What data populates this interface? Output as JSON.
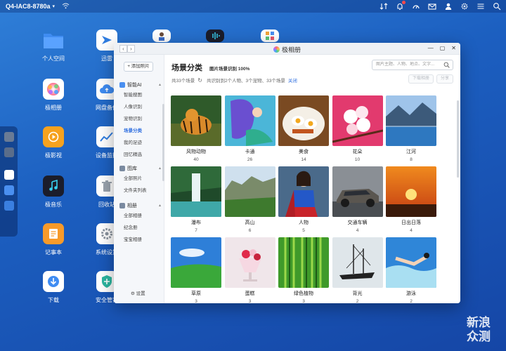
{
  "topbar": {
    "device_name": "Q4-IAC8-8780a"
  },
  "desktop": {
    "icons": [
      {
        "label": "个人空间",
        "color": "#3f8cf2"
      },
      {
        "label": "迅雷",
        "color": "#ffffff"
      },
      {
        "label": "极相册",
        "color": "#ffffff"
      },
      {
        "label": "网盘备份",
        "color": "#ffffff"
      },
      {
        "label": "极影视",
        "color": "#f6a21e"
      },
      {
        "label": "设备监控",
        "color": "#ffffff"
      },
      {
        "label": "极音乐",
        "color": "#1b1d2b"
      },
      {
        "label": "回收站",
        "color": "#ffffff"
      },
      {
        "label": "记事本",
        "color": "#f79a2a"
      },
      {
        "label": "系统设置",
        "color": "#ffffff"
      },
      {
        "label": "下载",
        "color": "#ffffff"
      },
      {
        "label": "安全管家",
        "color": "#ffffff"
      }
    ]
  },
  "window": {
    "title": "极相册",
    "nav_back": "‹",
    "nav_forward": "›"
  },
  "sidebar": {
    "add_button": "+ 添加照片",
    "groups": [
      {
        "title": "智能AI",
        "items": [
          "智能搜图",
          "人像识别",
          "宠物识别",
          "场景分类",
          "我的足迹",
          "回忆精选"
        ]
      },
      {
        "title": "图库",
        "items": [
          "全部照片",
          "文件夹列表"
        ]
      },
      {
        "title": "相册",
        "items": [
          "全部相册",
          "纪念册",
          "宝宝相册",
          "宝宝相册"
        ]
      }
    ],
    "settings_label": "设置"
  },
  "main": {
    "title": "场景分类",
    "status": "图片场景识别 100%",
    "search_placeholder": "图片主题、人物、地点、文字...",
    "count_text": "共33个场景",
    "recognized_text": "共识别到2个人物、3个宠物、33个场景",
    "close_link": "关闭",
    "btn_download": "下载相册",
    "btn_share": "分享"
  },
  "scenes": [
    {
      "name": "风物动物",
      "count": "40"
    },
    {
      "name": "卡通",
      "count": "26"
    },
    {
      "name": "美食",
      "count": "14"
    },
    {
      "name": "花朵",
      "count": "10"
    },
    {
      "name": "江河",
      "count": "8"
    },
    {
      "name": "瀑布",
      "count": "7"
    },
    {
      "name": "高山",
      "count": "6"
    },
    {
      "name": "人物",
      "count": "5"
    },
    {
      "name": "交通车辆",
      "count": "4"
    },
    {
      "name": "日出日落",
      "count": "4"
    },
    {
      "name": "草原",
      "count": "3"
    },
    {
      "name": "蛋糕",
      "count": "3"
    },
    {
      "name": "绿色植物",
      "count": "3"
    },
    {
      "name": "背光",
      "count": "2"
    },
    {
      "name": "游泳",
      "count": "2"
    }
  ],
  "watermark": "新浪众测"
}
